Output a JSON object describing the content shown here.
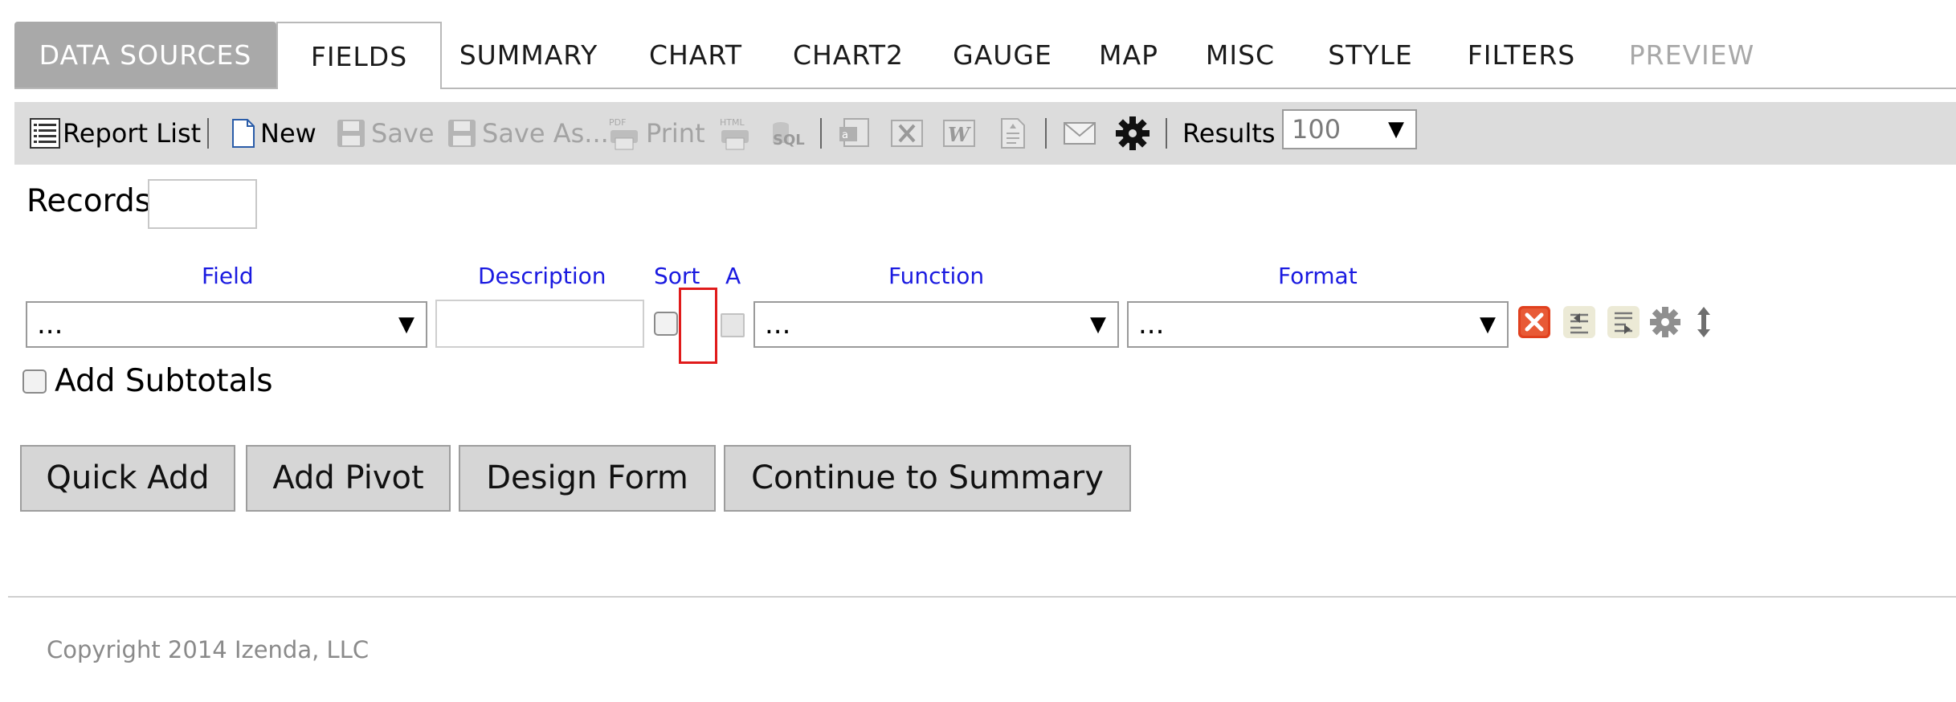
{
  "tabs": [
    {
      "label": "DATA SOURCES"
    },
    {
      "label": "FIELDS"
    },
    {
      "label": "SUMMARY"
    },
    {
      "label": "CHART"
    },
    {
      "label": "CHART2"
    },
    {
      "label": "GAUGE"
    },
    {
      "label": "MAP"
    },
    {
      "label": "MISC"
    },
    {
      "label": "STYLE"
    },
    {
      "label": "FILTERS"
    },
    {
      "label": "PREVIEW"
    }
  ],
  "toolbar": {
    "report_list": "Report List",
    "new": "New",
    "save": "Save",
    "save_as": "Save As...",
    "print": "Print",
    "results_label": "Results",
    "results_value": "100"
  },
  "records": {
    "label": "Records",
    "value": ""
  },
  "columns": {
    "field": "Field",
    "description": "Description",
    "sort": "Sort",
    "a": "A",
    "function": "Function",
    "format": "Format"
  },
  "row": {
    "field_value": "...",
    "description_value": "",
    "function_value": "...",
    "format_value": "..."
  },
  "subtotals": {
    "label": "Add Subtotals"
  },
  "buttons": {
    "quick_add": "Quick Add",
    "add_pivot": "Add Pivot",
    "design_form": "Design Form",
    "continue": "Continue to Summary"
  },
  "footer": {
    "copyright": "Copyright 2014 Izenda, LLC"
  },
  "colors": {
    "link_blue": "#1a1ae0",
    "tab_gray": "#a9a9a9",
    "toolbar_gray": "#dcdcdc",
    "delete_red": "#e0401e"
  }
}
